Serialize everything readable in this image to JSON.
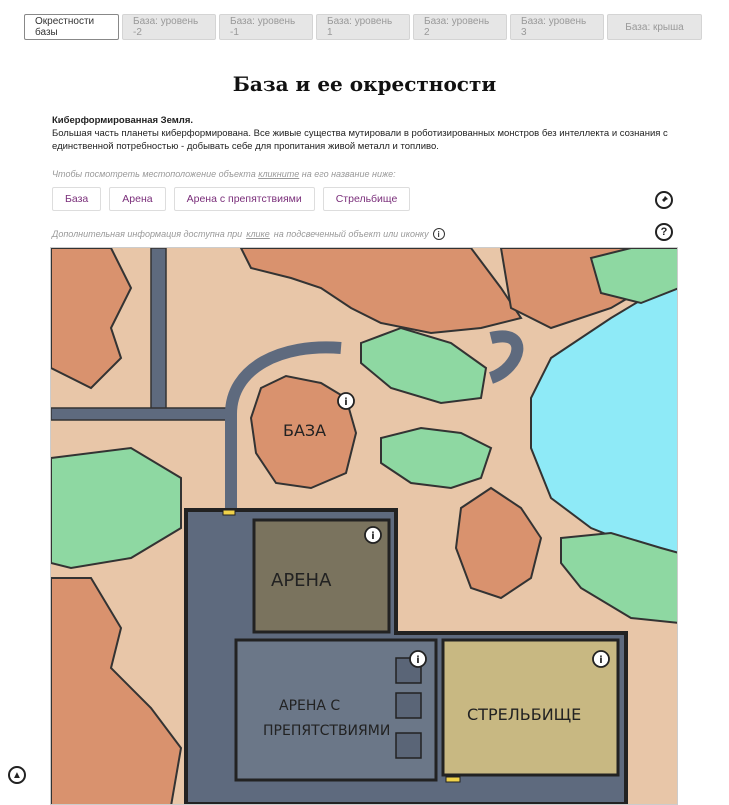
{
  "tabs": [
    {
      "label": "Окрестности базы",
      "active": true
    },
    {
      "label": "База: уровень -2"
    },
    {
      "label": "База: уровень -1"
    },
    {
      "label": "База: уровень 1"
    },
    {
      "label": "База: уровень 2"
    },
    {
      "label": "База: уровень 3"
    },
    {
      "label": "База: крыша"
    }
  ],
  "page": {
    "title": "База и ее окрестности",
    "desc_heading": "Киберформированная Земля.",
    "desc_text": "Большая часть планеты киберформирована. Все живые существа мутировали в роботизированных монстров без интеллекта и сознания с единственной потребностью - добывать себе для пропитания живой металл и топливо."
  },
  "hint": {
    "before": "Чтобы посмотреть местоположение объекта ",
    "link": "кликните",
    "after": " на его название ниже:"
  },
  "locations": [
    "База",
    "Арена",
    "Арена с препятствиями",
    "Стрельбище"
  ],
  "info_line": {
    "before": "Дополнительная информация доступна при ",
    "link": "клике",
    "after": " на подсвеченный объект или иконку"
  },
  "map": {
    "labels": {
      "base": "БАЗА",
      "arena": "АРЕНА",
      "obstacle_arena_1": "АРЕНА С",
      "obstacle_arena_2": "ПРЕПЯТСТВИЯМИ",
      "range": "СТРЕЛЬБИЩЕ"
    },
    "colors": {
      "ground": "#e8c6a8",
      "rock": "#d9926e",
      "grass": "#8ed8a2",
      "water": "#8eeaf7",
      "road": "#5e6a7e",
      "arena_floor": "#7a735e",
      "obstacle_floor": "#6b7788",
      "range_floor": "#c8b882",
      "wall": "#333333"
    }
  },
  "icons": {
    "pin": "pin-icon",
    "help": "question-icon",
    "info": "info-icon",
    "up": "arrow-up-icon"
  }
}
